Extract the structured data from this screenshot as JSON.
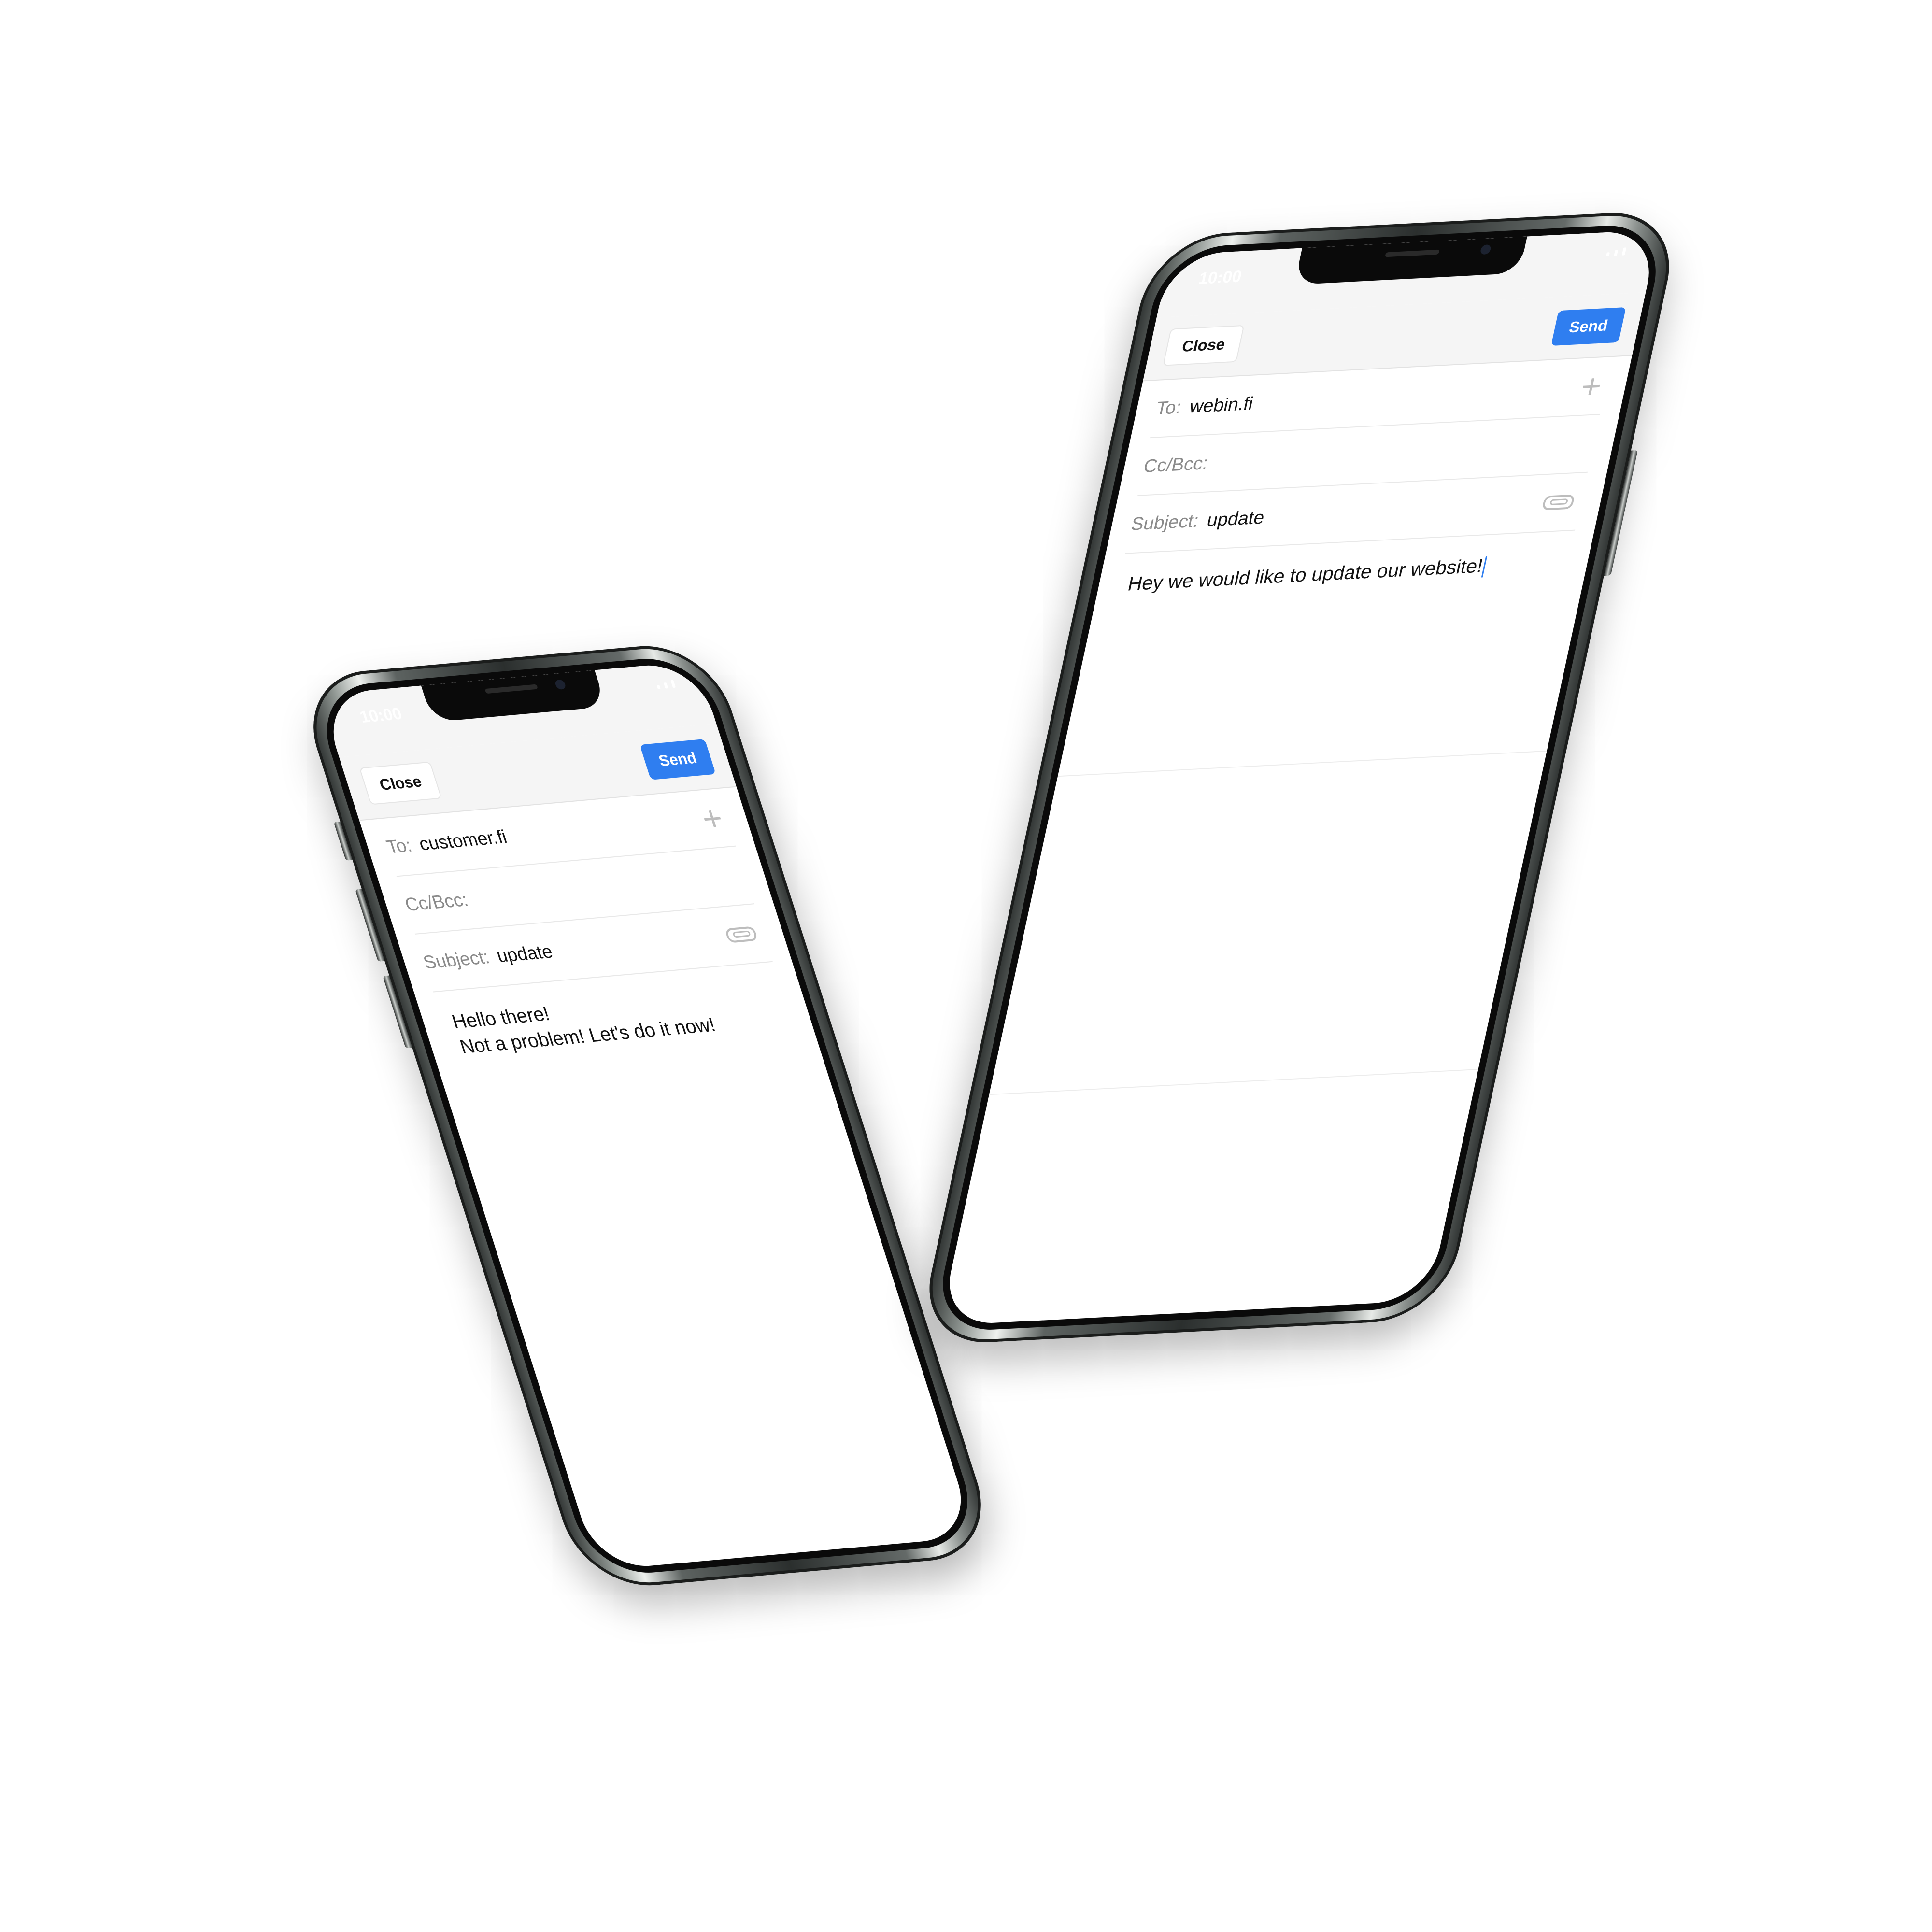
{
  "left_phone": {
    "status_time": "10:00",
    "toolbar": {
      "close_label": "Close",
      "send_label": "Send"
    },
    "to": {
      "label": "To:",
      "value": "customer.fi"
    },
    "ccbcc": {
      "label": "Cc/Bcc:"
    },
    "subject": {
      "label": "Subject:",
      "value": "update"
    },
    "body": {
      "line1": "Hello there!",
      "line2": "Not a problem! Let's do it now!"
    },
    "icons": {
      "add": "plus-icon",
      "attach": "paperclip-icon"
    }
  },
  "right_phone": {
    "status_time": "10:00",
    "toolbar": {
      "close_label": "Close",
      "send_label": "Send"
    },
    "to": {
      "label": "To:",
      "value": "webin.fi"
    },
    "ccbcc": {
      "label": "Cc/Bcc:"
    },
    "subject": {
      "label": "Subject:",
      "value": "update"
    },
    "body": {
      "line1": "Hey we would like to update our website!"
    },
    "icons": {
      "add": "plus-icon",
      "attach": "paperclip-icon"
    }
  },
  "colors": {
    "accent": "#2f7ef0",
    "toolbar_bg": "#f5f5f5",
    "label_gray": "#8a8a8a"
  }
}
